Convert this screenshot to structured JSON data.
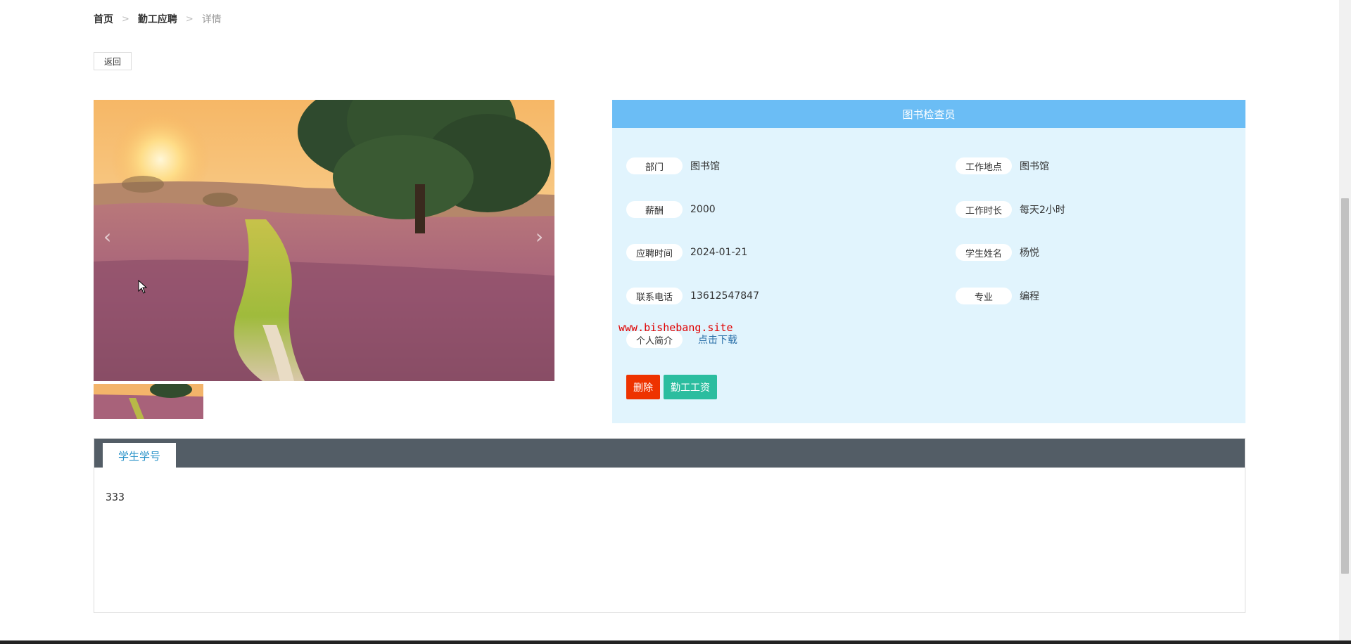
{
  "breadcrumb": {
    "home": "首页",
    "section": "勤工应聘",
    "current": "详情",
    "separator": ">"
  },
  "back_button": "返回",
  "job": {
    "title": "图书检查员"
  },
  "fields": {
    "department": {
      "label": "部门",
      "value": "图书馆"
    },
    "location": {
      "label": "工作地点",
      "value": "图书馆"
    },
    "salary": {
      "label": "薪酬",
      "value": "2000"
    },
    "hours": {
      "label": "工作时长",
      "value": "每天2小时"
    },
    "apply_time": {
      "label": "应聘时间",
      "value": "2024-01-21"
    },
    "student_name": {
      "label": "学生姓名",
      "value": "杨悦"
    },
    "phone": {
      "label": "联系电话",
      "value": "13612547847"
    },
    "major": {
      "label": "专业",
      "value": "编程"
    },
    "intro": {
      "label": "个人简介",
      "link": "点击下载"
    }
  },
  "watermark": "www.bishebang.site",
  "actions": {
    "delete": "删除",
    "wage": "勤工工资"
  },
  "tabs": [
    {
      "label": "学生学号",
      "content": "333"
    }
  ],
  "icons": {
    "carousel_prev": "chevron-left-icon",
    "carousel_next": "chevron-right-icon",
    "cursor": "mouse-pointer-icon"
  },
  "colors": {
    "header_blue": "#6bbdf5",
    "panel_bg": "#e1f4fd",
    "delete_red": "#ee3300",
    "wage_teal": "#2bbd9f",
    "tab_bar": "#535d66",
    "watermark_red": "#e00000"
  }
}
